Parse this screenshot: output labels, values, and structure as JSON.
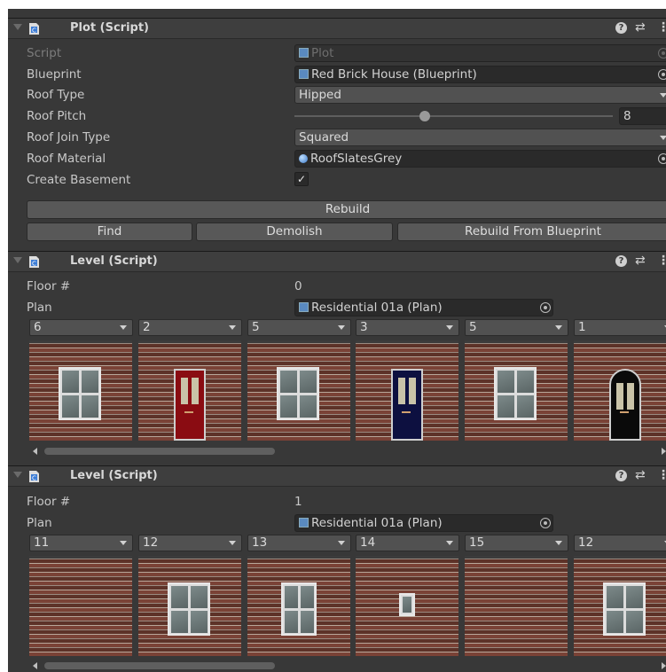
{
  "plot": {
    "title": "Plot (Script)",
    "script_label": "Script",
    "script_value": "Plot",
    "blueprint_label": "Blueprint",
    "blueprint_value": "Red Brick House (Blueprint)",
    "roof_type_label": "Roof Type",
    "roof_type_value": "Hipped",
    "roof_pitch_label": "Roof Pitch",
    "roof_pitch_value": "8",
    "roof_pitch_fraction": 0.41,
    "roof_join_label": "Roof Join Type",
    "roof_join_value": "Squared",
    "roof_material_label": "Roof Material",
    "roof_material_value": "RoofSlatesGrey",
    "basement_label": "Create Basement",
    "basement_checked": "✓",
    "rebuild_label": "Rebuild",
    "find_label": "Find",
    "demolish_label": "Demolish",
    "rebuild_blueprint_label": "Rebuild From Blueprint"
  },
  "levels": [
    {
      "title": "Level (Script)",
      "floor_label": "Floor #",
      "floor_value": "0",
      "plan_label": "Plan",
      "plan_value": "Residential 01a (Plan)",
      "tiles": [
        {
          "index": "6",
          "type": "window"
        },
        {
          "index": "2",
          "type": "door-red"
        },
        {
          "index": "5",
          "type": "window"
        },
        {
          "index": "3",
          "type": "door-navy"
        },
        {
          "index": "5",
          "type": "window"
        },
        {
          "index": "1",
          "type": "door-black-arch"
        }
      ]
    },
    {
      "title": "Level (Script)",
      "floor_label": "Floor #",
      "floor_value": "1",
      "plan_label": "Plan",
      "plan_value": "Residential 01a (Plan)",
      "tiles": [
        {
          "index": "11",
          "type": "plain"
        },
        {
          "index": "12",
          "type": "window"
        },
        {
          "index": "13",
          "type": "window-narrow"
        },
        {
          "index": "14",
          "type": "window-small"
        },
        {
          "index": "15",
          "type": "plain"
        },
        {
          "index": "12",
          "type": "window"
        }
      ]
    }
  ],
  "header_icons": {
    "help": "?",
    "presets": "⇄",
    "menu": "⋮"
  },
  "colors": {
    "panel": "#383838",
    "header": "#3e3e3e",
    "field": "#2a2a2a",
    "dropdown": "#515151",
    "button": "#585858"
  }
}
